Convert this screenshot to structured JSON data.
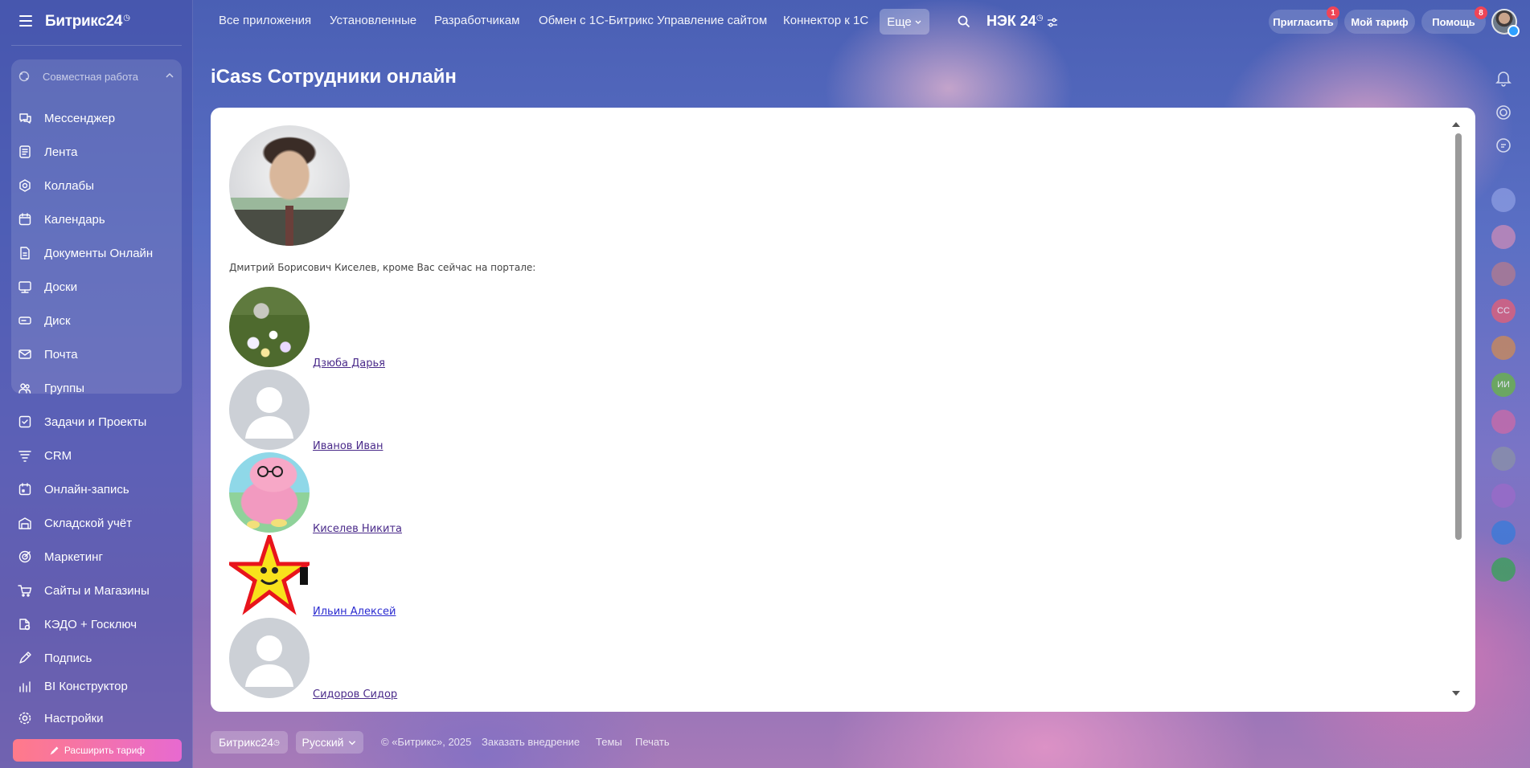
{
  "app": {
    "logo": "Битрикс24",
    "logo_clock": "◷"
  },
  "sidebar": {
    "group_title": "Совместная работа",
    "items": [
      {
        "label": "Мессенджер",
        "icon": "chat-icon"
      },
      {
        "label": "Лента",
        "icon": "feed-icon"
      },
      {
        "label": "Коллабы",
        "icon": "collab-icon"
      },
      {
        "label": "Календарь",
        "icon": "calendar-icon"
      },
      {
        "label": "Документы Онлайн",
        "icon": "document-icon"
      },
      {
        "label": "Доски",
        "icon": "board-icon"
      },
      {
        "label": "Диск",
        "icon": "disk-icon"
      },
      {
        "label": "Почта",
        "icon": "mail-icon"
      },
      {
        "label": "Группы",
        "icon": "groups-icon"
      },
      {
        "label": "Задачи и Проекты",
        "icon": "tasks-icon"
      },
      {
        "label": "CRM",
        "icon": "crm-icon"
      },
      {
        "label": "Онлайн-запись",
        "icon": "booking-icon"
      },
      {
        "label": "Складской учёт",
        "icon": "warehouse-icon"
      },
      {
        "label": "Маркетинг",
        "icon": "marketing-icon"
      },
      {
        "label": "Сайты и Магазины",
        "icon": "cart-icon"
      },
      {
        "label": "КЭДО + Госключ",
        "icon": "kedo-icon"
      },
      {
        "label": "Подпись",
        "icon": "signature-icon"
      },
      {
        "label": "BI Конструктор",
        "icon": "bi-icon"
      }
    ],
    "settings_label": "Настройки",
    "upgrade_label": "Расширить тариф"
  },
  "topnav": {
    "links": [
      "Все приложения",
      "Установленные",
      "Разработчикам",
      "Обмен с 1С-Битрикс Управление сайтом",
      "Коннектор к 1С"
    ],
    "more_label": "Еще",
    "company": "НЭК 24",
    "invite_label": "Пригласить",
    "invite_badge": "1",
    "tariff_label": "Мой тариф",
    "help_label": "Помощь",
    "help_badge": "8"
  },
  "page": {
    "title": "iCass Сотрудники онлайн",
    "intro": "Дмитрий Борисович Киселев, кроме Вас сейчас на портале:",
    "people": [
      {
        "name": "Дзюба Дарья",
        "photo": "flowers-photo"
      },
      {
        "name": "Иванов Иван",
        "photo": "default-avatar"
      },
      {
        "name": "Киселев Никита",
        "photo": "pig-avatar"
      },
      {
        "name": "Ильин Алексей",
        "photo": "star-avatar"
      },
      {
        "name": "Сидоров Сидор",
        "photo": "default-avatar"
      }
    ]
  },
  "right_rail": {
    "circles": [
      "",
      "",
      "",
      "СС",
      "",
      "ИИ",
      "",
      "",
      "",
      "",
      ""
    ]
  },
  "footer": {
    "brand_chip": "Битрикс24",
    "language": "Русский",
    "copyright": "© «Битрикс», 2025",
    "order_link": "Заказать внедрение",
    "themes_link": "Темы",
    "print_link": "Печать"
  },
  "colors": {
    "accent_upgrade_from": "#ff7a8a",
    "accent_upgrade_to": "#e76ad0",
    "badge": "#ef4557",
    "link": "#4a2a8a",
    "rail_cc": "#e0607a",
    "rail_ii": "#6ab34a"
  }
}
